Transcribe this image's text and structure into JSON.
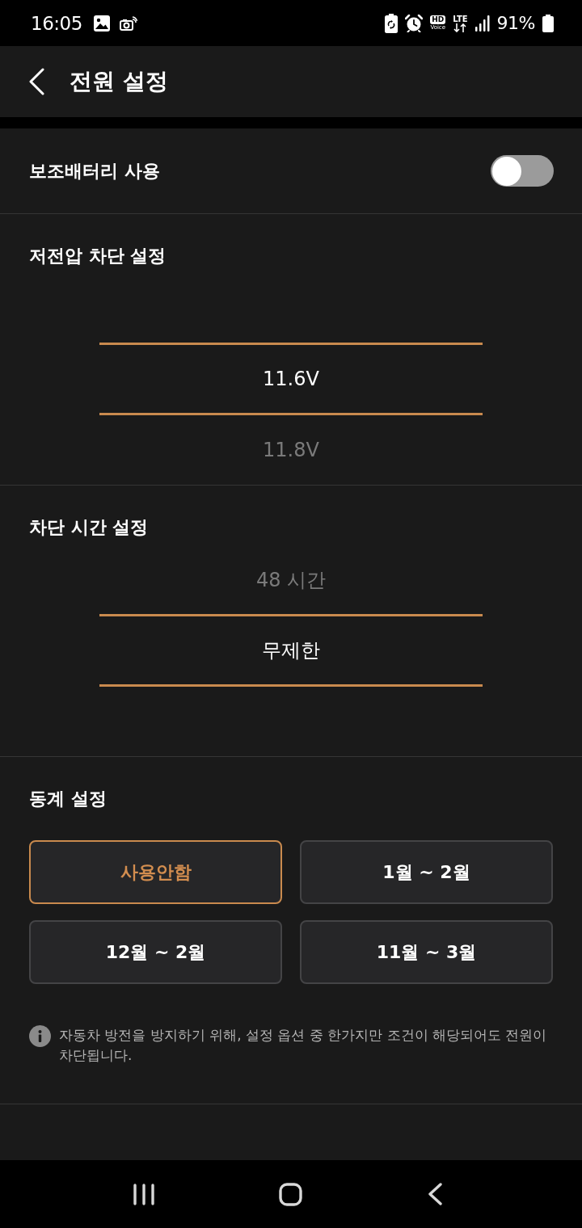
{
  "status_bar": {
    "time": "16:05",
    "hd_label": "HD",
    "voice_label": "Voice",
    "network": "LTE",
    "battery": "91%"
  },
  "app_bar": {
    "title": "전원 설정"
  },
  "aux_battery": {
    "label": "보조배터리 사용",
    "on": false
  },
  "sections": [
    {
      "kind": "picker",
      "title": "저전압 차단 설정",
      "options": [
        {
          "label": "11.6V",
          "selected": true
        },
        {
          "label": "11.8V",
          "selected": false
        }
      ]
    },
    {
      "kind": "picker",
      "title": "차단 시간 설정",
      "options": [
        {
          "label": "48 시간",
          "selected": false
        },
        {
          "label": "무제한",
          "selected": true
        }
      ]
    },
    {
      "kind": "choices",
      "title": "동계 설정",
      "options": [
        {
          "label": "사용안함",
          "selected": true
        },
        {
          "label": "1월 ~ 2월",
          "selected": false
        },
        {
          "label": "12월 ~ 2월",
          "selected": false
        },
        {
          "label": "11월 ~ 3월",
          "selected": false
        }
      ],
      "note": "자동차 방전을 방지하기 위해, 설정 옵션 중 한가지만 조건이 해당되어도 전원이 차단됩니다."
    }
  ]
}
